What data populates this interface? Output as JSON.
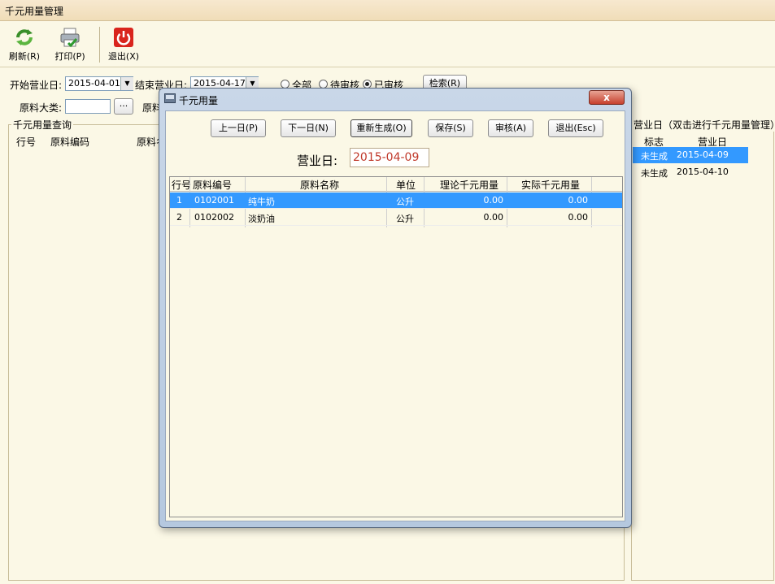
{
  "window": {
    "title": "千元用量管理"
  },
  "toolbar": {
    "refresh_label": "刷新(R)",
    "print_label": "打印(P)",
    "exit_label": "退出(X)"
  },
  "filters": {
    "start_label": "开始营业日:",
    "start_value": "2015-04-01",
    "end_label": "结束营业日:",
    "end_value": "2015-04-17",
    "radio_all": "全部",
    "radio_pending": "待审核",
    "radio_approved": "已审核",
    "search_label": "检索(R)",
    "category_label": "原料大类:",
    "category_value": "",
    "ellipsis": "···",
    "material_label": "原料"
  },
  "left_panel": {
    "title": "千元用量查询",
    "columns": [
      "行号",
      "原料编码",
      "原料名"
    ]
  },
  "right_panel": {
    "title": "营业日（双击进行千元用量管理）",
    "columns": [
      "标志",
      "营业日"
    ],
    "rows": [
      {
        "flag": "未生成",
        "date": "2015-04-09",
        "selected": true
      },
      {
        "flag": "未生成",
        "date": "2015-04-10",
        "selected": false
      }
    ]
  },
  "modal": {
    "title": "千元用量",
    "close": "x",
    "buttons": {
      "prev": "上一日(P)",
      "next": "下一日(N)",
      "regen": "重新生成(O)",
      "save": "保存(S)",
      "audit": "审核(A)",
      "exit": "退出(Esc)"
    },
    "business_day_label": "营业日:",
    "business_day_value": "2015-04-09",
    "columns": [
      "行号",
      "原料编号",
      "原料名称",
      "单位",
      "理论千元用量",
      "实际千元用量"
    ],
    "rows": [
      {
        "no": "1",
        "code": "0102001",
        "name": "纯牛奶",
        "unit": "公升",
        "theory": "0.00",
        "actual": "0.00",
        "selected": true
      },
      {
        "no": "2",
        "code": "0102002",
        "name": "淡奶油",
        "unit": "公升",
        "theory": "0.00",
        "actual": "0.00",
        "selected": false
      }
    ]
  },
  "colors": {
    "selection": "#3399ff",
    "background": "#fbf8e6",
    "red_value": "#c0392b"
  }
}
